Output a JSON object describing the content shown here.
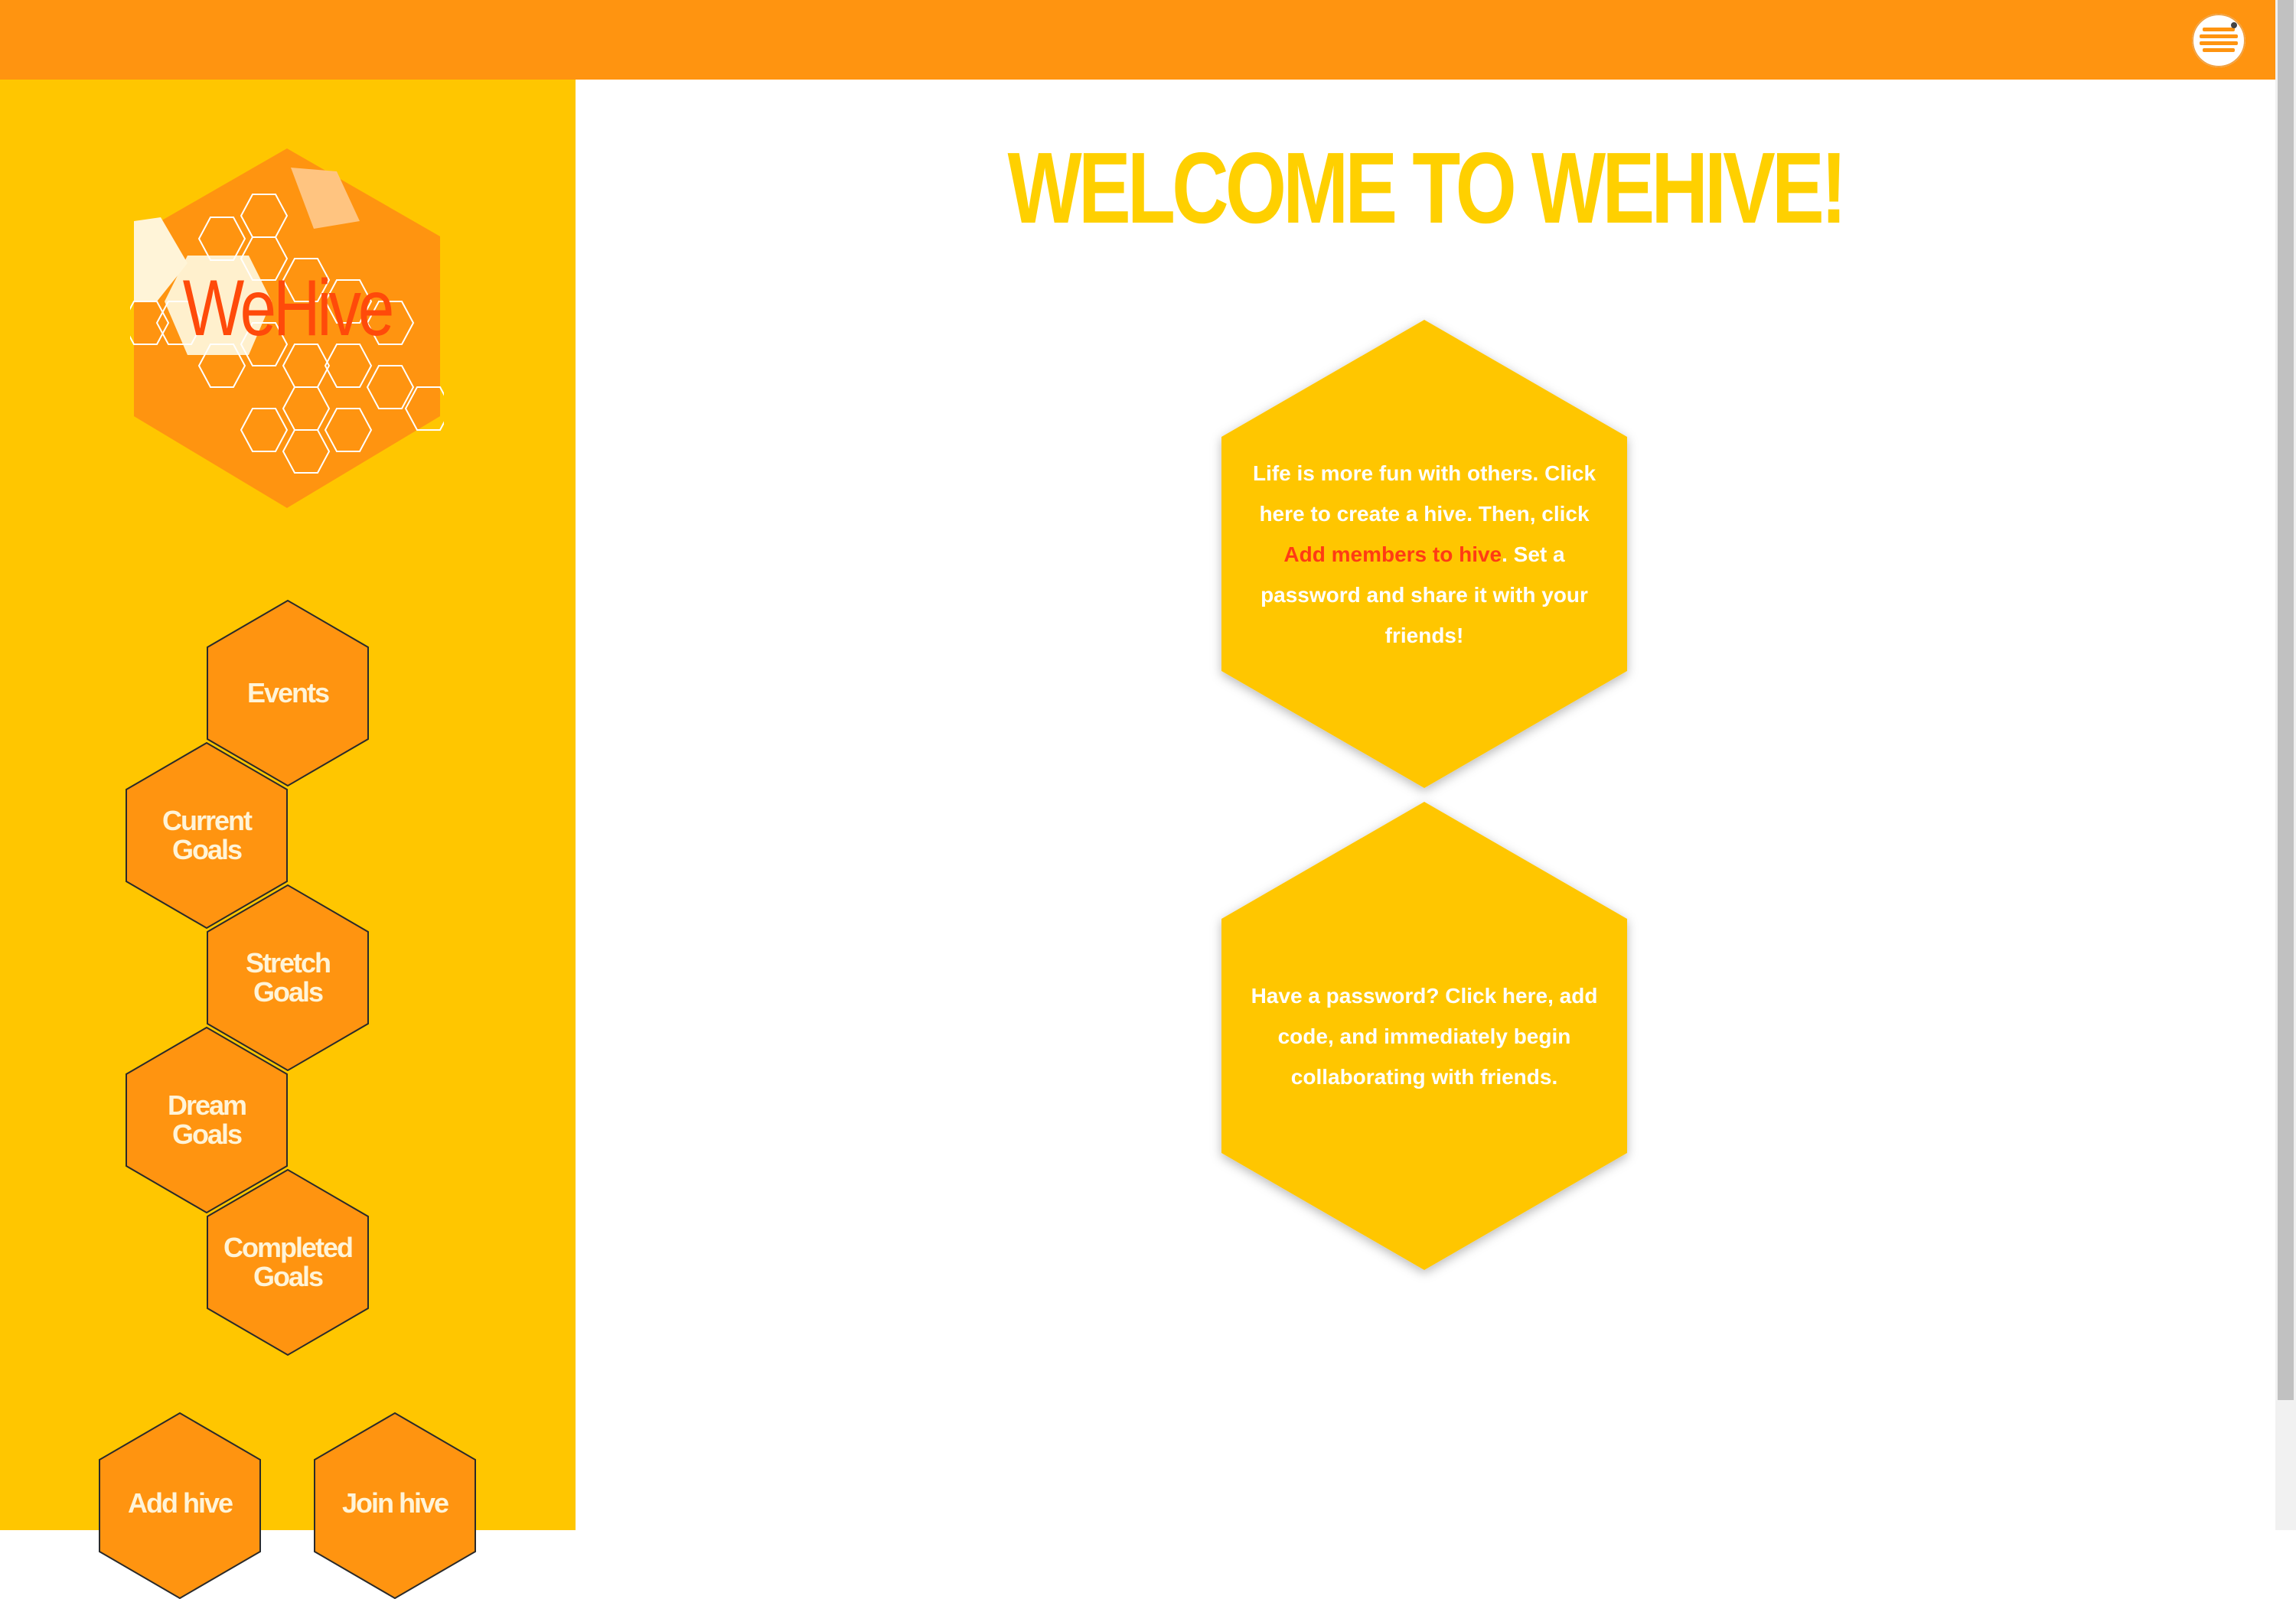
{
  "topbar": {
    "accent": "#ff9410",
    "avatar_icon": "honeycomb-avatar-icon"
  },
  "sidebar": {
    "background": "#ffc600",
    "logo_text": "WeHive",
    "nav": [
      {
        "label": "Events"
      },
      {
        "label": "Current Goals"
      },
      {
        "label": "Stretch Goals"
      },
      {
        "label": "Dream Goals"
      },
      {
        "label": "Completed Goals"
      }
    ],
    "actions": [
      {
        "label": "Add hive"
      },
      {
        "label": "Join hive"
      }
    ]
  },
  "main": {
    "title": "WELCOME TO WEHIVE!",
    "create_card": {
      "text_before": "Life is more fun with others. Click here to create a hive. Then, click ",
      "highlight": "Add members to hive",
      "text_after": ". Set a password and share it with your friends!"
    },
    "join_card": {
      "text": "Have a password? Click here, add code, and immediately begin collaborating with friends."
    }
  },
  "colors": {
    "hex_orange": "#ff9410",
    "hex_yellow": "#ffc600",
    "title_yellow": "#ffd000",
    "link_red": "#ff3b14"
  }
}
